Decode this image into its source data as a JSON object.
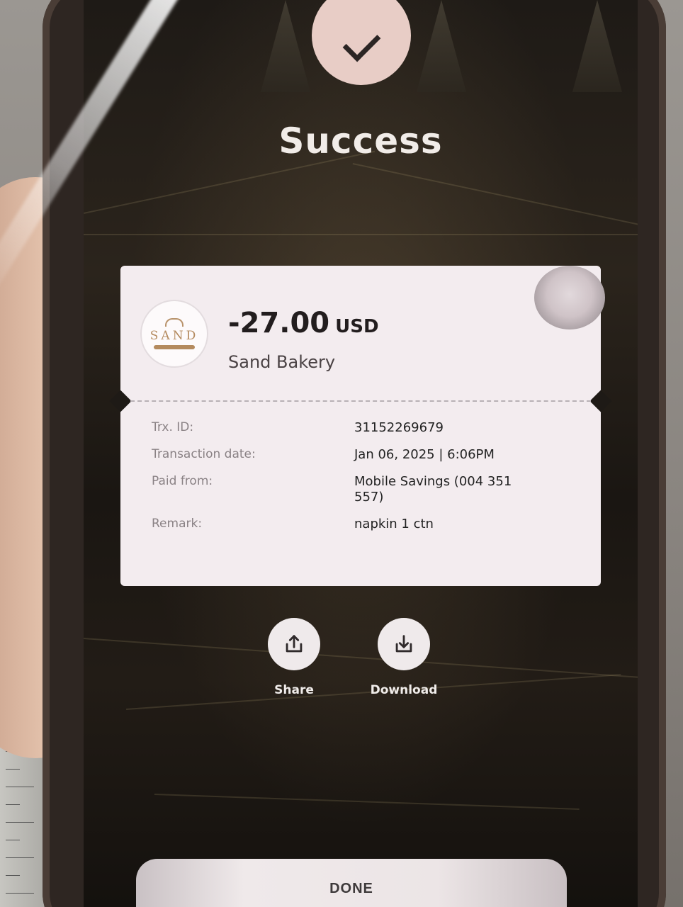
{
  "status": {
    "title": "Success"
  },
  "receipt": {
    "logo_text": "SAND",
    "amount": "-27.00",
    "currency": "USD",
    "merchant": "Sand Bakery",
    "details": [
      {
        "label": "Trx. ID:",
        "value": "31152269679"
      },
      {
        "label": "Transaction date:",
        "value": "Jan 06, 2025 | 6:06PM"
      },
      {
        "label": "Paid from:",
        "value": "Mobile Savings (004 351 557)"
      },
      {
        "label": "Remark:",
        "value": "napkin 1 ctn"
      }
    ]
  },
  "actions": {
    "share_label": "Share",
    "download_label": "Download"
  },
  "footer": {
    "done_label": "DONE"
  },
  "colors": {
    "receipt_bg": "#f3ecef",
    "check_circle": "#e8cdc6",
    "screen_bg": "#1e1a16"
  },
  "icons": {
    "status": "check-icon",
    "share": "share-icon",
    "download": "download-icon"
  }
}
